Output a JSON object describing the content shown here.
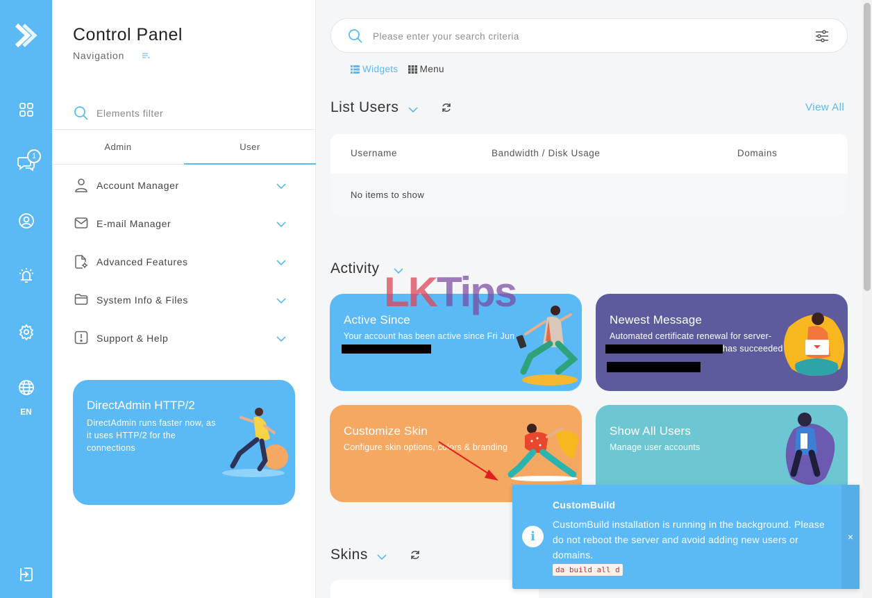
{
  "rail": {
    "items": [
      {
        "icon": "logo-icon"
      },
      {
        "icon": "dashboard-grid-icon"
      },
      {
        "icon": "messages-icon",
        "badge": "1"
      },
      {
        "icon": "user-circle-icon"
      },
      {
        "icon": "alarm-icon"
      },
      {
        "icon": "gear-icon"
      },
      {
        "icon": "globe-icon",
        "label": "EN"
      },
      {
        "icon": "logout-icon"
      }
    ]
  },
  "nav": {
    "title": "Control Panel",
    "subtitle": "Navigation",
    "filter_placeholder": "Elements filter",
    "tabs": [
      {
        "label": "Admin",
        "active": false
      },
      {
        "label": "User",
        "active": true
      }
    ],
    "items": [
      {
        "label": "Account Manager",
        "icon": "person-icon"
      },
      {
        "label": "E-mail Manager",
        "icon": "envelope-icon"
      },
      {
        "label": "Advanced Features",
        "icon": "document-gear-icon"
      },
      {
        "label": "System Info & Files",
        "icon": "folder-icon"
      },
      {
        "label": "Support & Help",
        "icon": "alert-box-icon"
      }
    ],
    "promo": {
      "title": "DirectAdmin HTTP/2",
      "text": "DirectAdmin runs faster now, as it uses HTTP/2 for the connections"
    }
  },
  "search": {
    "placeholder": "Please enter your search criteria"
  },
  "view_tabs": [
    {
      "label": "Widgets",
      "active": true,
      "icon": "list-icon"
    },
    {
      "label": "Menu",
      "active": false,
      "icon": "grid-icon"
    }
  ],
  "list_users": {
    "title": "List Users",
    "view_all": "View All",
    "columns": [
      "Username",
      "Bandwidth / Disk Usage",
      "Domains"
    ],
    "empty_text": "No items to show"
  },
  "activity": {
    "title": "Activity",
    "cards": [
      {
        "title": "Active Since",
        "text": "Your account has been active since Fri Jun",
        "color": "#5bb9f5"
      },
      {
        "title": "Newest Message",
        "text": "Automated certificate renewal for server-",
        "text2": "has succeeded",
        "color": "#5d5b9e"
      },
      {
        "title": "Customize Skin",
        "text": "Configure skin options, colors & branding",
        "color": "#f5a862"
      },
      {
        "title": "Show All Users",
        "text": "Manage user accounts",
        "color": "#6cc7d3"
      }
    ]
  },
  "watermark": {
    "part1": "LK",
    "part2": "Tips"
  },
  "skins": {
    "title": "Skins"
  },
  "toast": {
    "title": "CustomBuild",
    "message": "CustomBuild installation is running in the background. Please do not reboot the server and avoid adding new users or domains.",
    "code": "da build all d",
    "close": "×",
    "icon": "info-icon"
  },
  "colors": {
    "accent": "#5bb9f5",
    "purple": "#5d5b9e",
    "orange": "#f5a862",
    "teal": "#6cc7d3"
  }
}
